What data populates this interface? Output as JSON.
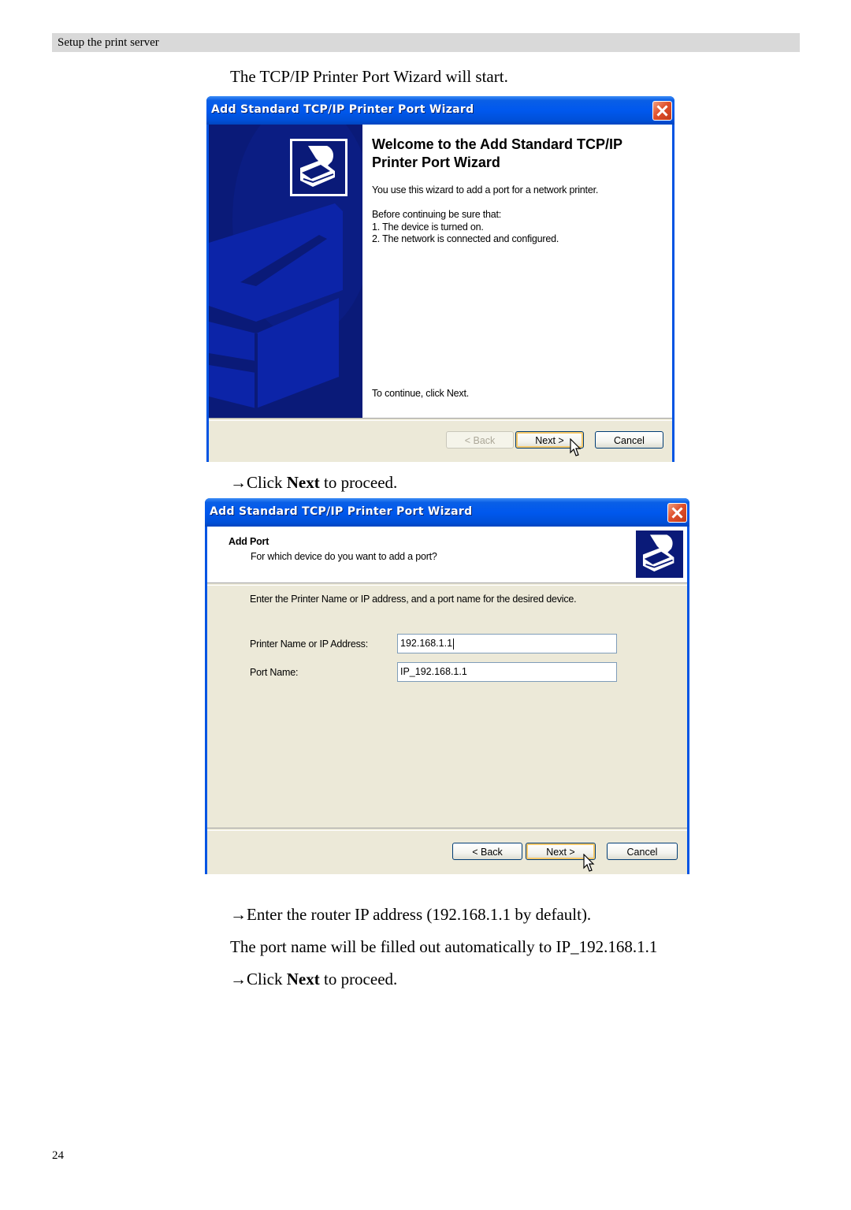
{
  "header": {
    "section_title": "Setup the print server"
  },
  "intro_text": "The TCP/IP Printer Port Wizard will start.",
  "step1": {
    "prefix": "→Click ",
    "bold": "Next",
    "suffix": " to proceed."
  },
  "window1": {
    "title": "Add Standard TCP/IP Printer Port Wizard",
    "heading": "Welcome to the Add Standard TCP/IP Printer Port Wizard",
    "heading_line1": "Welcome to the Add Standard TCP/IP",
    "heading_line2": "Printer Port Wizard",
    "description": "You use this wizard to add a port for a network printer.",
    "before_label": "Before continuing be sure that:",
    "checklist": [
      "1.  The device is turned on.",
      "2.  The network is connected and configured."
    ],
    "continue_text": "To continue, click Next.",
    "buttons": {
      "back": "< Back",
      "next": "Next >",
      "cancel": "Cancel"
    },
    "back_enabled": false,
    "icons": {
      "wizard": "printer-icon",
      "close": "close-icon",
      "cursor": "mouse-pointer-icon"
    }
  },
  "window2": {
    "title": "Add Standard TCP/IP Printer Port Wizard",
    "page_title": "Add Port",
    "page_subtitle": "For which device do you want to add a port?",
    "instruction": "Enter the Printer Name or IP address, and a port name for the desired device.",
    "fields": {
      "printer_label": "Printer Name or IP Address:",
      "printer_value": "192.168.1.1",
      "port_label": "Port Name:",
      "port_value": "IP_192.168.1.1"
    },
    "buttons": {
      "back": "< Back",
      "next": "Next >",
      "cancel": "Cancel"
    },
    "back_enabled": true
  },
  "step2": {
    "text": "→Enter the router IP address (192.168.1.1 by default)."
  },
  "step3": {
    "text": "The port name will be filled out automatically to IP_192.168.1.1"
  },
  "step4": {
    "prefix": "→Click ",
    "bold": "Next",
    "suffix": " to proceed."
  },
  "footer": {
    "page_number": "24"
  },
  "colors": {
    "titlebar_blue": "#0058ee",
    "side_panel_navy": "#0a1a78",
    "dialog_beige": "#ece9d8",
    "header_gray": "#d9d9d9"
  }
}
